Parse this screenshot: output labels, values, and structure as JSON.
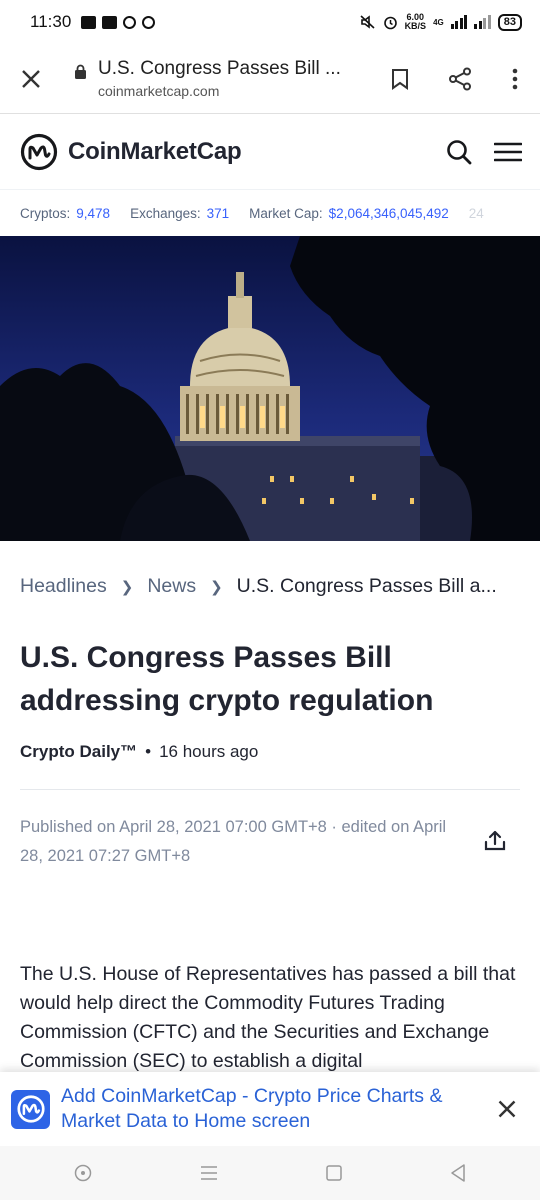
{
  "status": {
    "time": "11:30",
    "speed_top": "6.00",
    "speed_bottom": "KB/S",
    "network": "4G",
    "battery": "83"
  },
  "browser": {
    "title": "U.S. Congress Passes Bill ...",
    "url": "coinmarketcap.com"
  },
  "site": {
    "name": "CoinMarketCap"
  },
  "stats": [
    {
      "label": "Cryptos:",
      "value": "9,478"
    },
    {
      "label": "Exchanges:",
      "value": "371"
    },
    {
      "label": "Market Cap:",
      "value": "$2,064,346,045,492"
    }
  ],
  "stats_overflow": "24",
  "breadcrumb": {
    "items": [
      "Headlines",
      "News"
    ],
    "current": "U.S. Congress Passes Bill a..."
  },
  "article": {
    "title": "U.S. Congress Passes Bill addressing crypto regulation",
    "author": "Crypto Daily™",
    "time_ago": "16 hours ago",
    "published": "Published on April 28, 2021 07:00 GMT+8 · edited on April 28, 2021 07:27 GMT+8",
    "body": "The U.S. House of Representatives has passed a bill that would help direct the Commodity Futures Trading Commission (CFTC) and the Securities and Exchange Commission (SEC) to establish a digital"
  },
  "banner": {
    "text": "Add CoinMarketCap - Crypto Price Charts & Market Data to Home screen"
  },
  "colors": {
    "accent": "#3861fb",
    "text": "#222531",
    "muted": "#58667e",
    "banner_link": "#2a62d6"
  }
}
